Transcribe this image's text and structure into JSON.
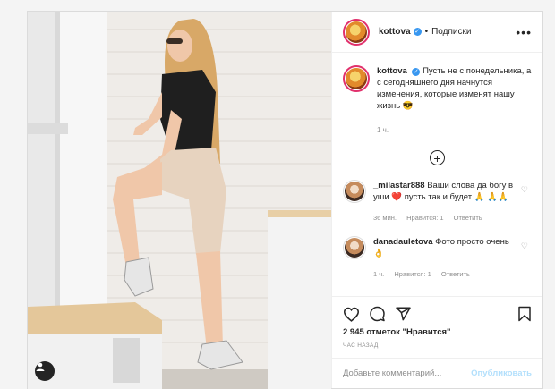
{
  "post": {
    "username": "kottova",
    "separator": "•",
    "follow_label": "Подписки",
    "more_label": "•••",
    "caption": {
      "username": "kottova",
      "text": "Пусть не с понедельника, а с сегодняшнего дня начнутся изменения, которые изменят нашу жизнь 😎",
      "time": "1 ч."
    },
    "load_more_label": "+",
    "comments": [
      {
        "username": "_milastar888",
        "text": "Ваши слова да богу в уши ❤️ пусть так и будет 🙏 🙏🙏",
        "time": "36 мин.",
        "likes": "Нравится: 1",
        "reply": "Ответить"
      },
      {
        "username": "danadauletova",
        "text": "Фото просто очень👌",
        "time": "1 ч.",
        "likes": "Нравится: 1",
        "reply": "Ответить"
      }
    ],
    "likes_text": "2 945 отметок \"Нравится\"",
    "posted_when": "ЧАС НАЗАД",
    "comment_placeholder": "Добавьте комментарий...",
    "publish_label": "Опубликовать",
    "icons": [
      "heart-icon",
      "comment-icon",
      "share-icon",
      "bookmark-icon",
      "user-tag-icon"
    ],
    "colors": {
      "accent_link": "#b2dffc",
      "verified": "#3897f0",
      "muted": "#8e8e8e"
    }
  }
}
